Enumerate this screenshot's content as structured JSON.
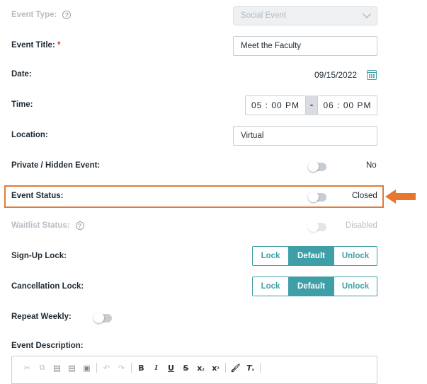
{
  "event_type": {
    "label": "Event Type:",
    "value": "Social Event"
  },
  "event_title": {
    "label": "Event Title:",
    "required_mark": "*",
    "value": "Meet the Faculty"
  },
  "date": {
    "label": "Date:",
    "value": "09/15/2022"
  },
  "time": {
    "label": "Time:",
    "start": {
      "hour": "05",
      "sep": ":",
      "minute": "00",
      "ampm": "PM"
    },
    "dash": "-",
    "end": {
      "hour": "06",
      "sep": ":",
      "minute": "00",
      "ampm": "PM"
    }
  },
  "location": {
    "label": "Location:",
    "value": "Virtual"
  },
  "private_hidden": {
    "label": "Private / Hidden Event:",
    "value": "No",
    "on": false
  },
  "event_status": {
    "label": "Event Status:",
    "value": "Closed",
    "on": false
  },
  "waitlist_status": {
    "label": "Waitlist Status:",
    "value": "Disabled",
    "on": false
  },
  "signup_lock": {
    "label": "Sign-Up Lock:",
    "options": [
      "Lock",
      "Default",
      "Unlock"
    ],
    "selected": "Default"
  },
  "cancellation_lock": {
    "label": "Cancellation Lock:",
    "options": [
      "Lock",
      "Default",
      "Unlock"
    ],
    "selected": "Default"
  },
  "repeat_weekly": {
    "label": "Repeat Weekly:",
    "on": false
  },
  "event_description": {
    "label": "Event Description:",
    "toolbar": [
      "cut-icon",
      "copy-icon",
      "paste-icon",
      "paste-text-icon",
      "paste-word-icon",
      "undo-icon",
      "redo-icon",
      "bold-icon",
      "italic-icon",
      "underline-icon",
      "strikethrough-icon",
      "subscript-icon",
      "superscript-icon",
      "format-painter-icon",
      "clear-format-icon"
    ],
    "toolbar_glyphs": {
      "bold": "B",
      "italic": "I",
      "underline": "U",
      "strike": "S",
      "sub": "x",
      "sub_mark": "₂",
      "sup": "x",
      "sup_mark": "²",
      "clear": "T",
      "clear_mark": "ₓ"
    }
  },
  "colors": {
    "accent": "#3f9fa7",
    "highlight": "#e07b39",
    "required": "#d6312b"
  }
}
